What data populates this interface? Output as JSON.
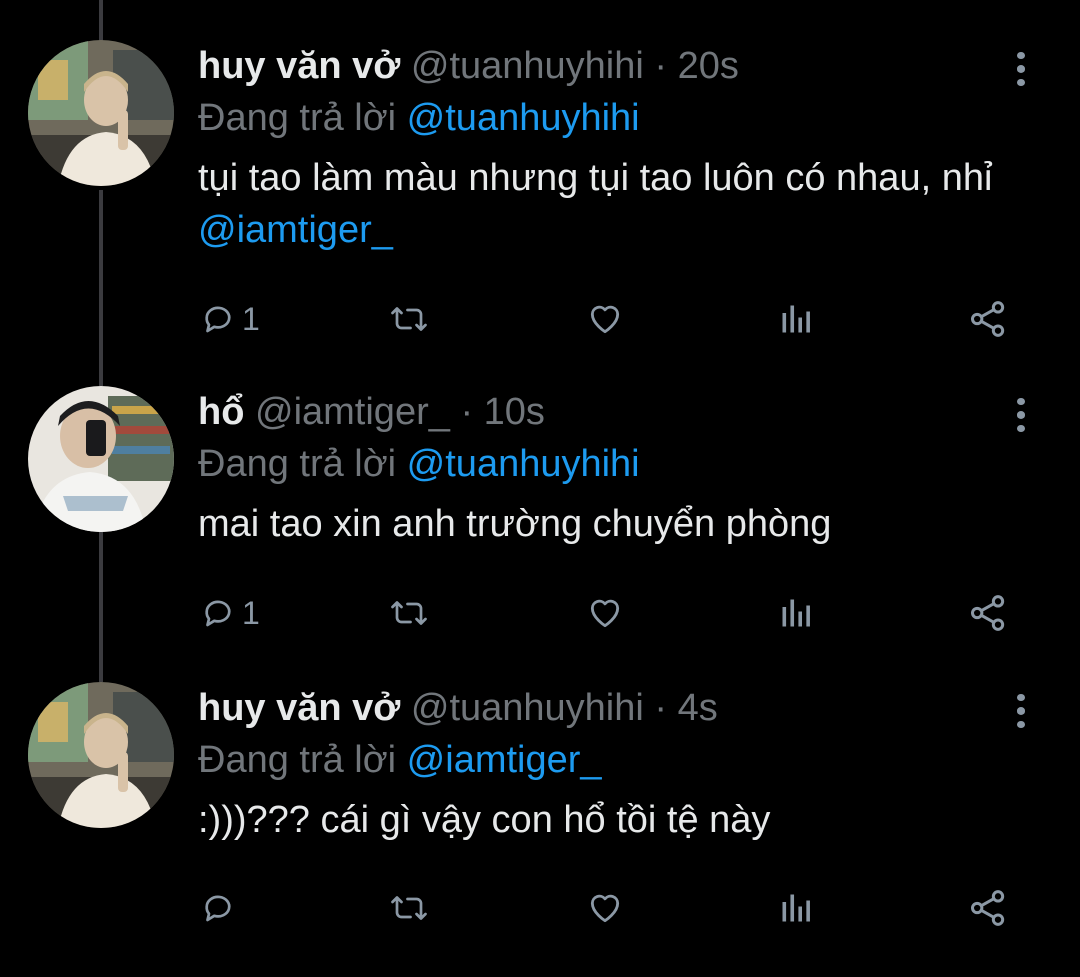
{
  "tweets": [
    {
      "display_name": "huy văn vở",
      "handle": "@tuanhuyhihi",
      "time": "· 20s",
      "reply_prefix": "Đang trả lời",
      "reply_to": "@tuanhuyhihi",
      "text": "tụi tao làm màu nhưng tụi tao luôn có nhau, nhỉ ",
      "text_mention": "@iamtiger_",
      "reply_count": "1"
    },
    {
      "display_name": "hổ",
      "handle": "@iamtiger_",
      "time": "· 10s",
      "reply_prefix": "Đang trả lời",
      "reply_to": "@tuanhuyhihi",
      "text": "mai tao xin anh trường chuyển phòng",
      "text_mention": "",
      "reply_count": "1"
    },
    {
      "display_name": "huy văn vở",
      "handle": "@tuanhuyhihi",
      "time": "· 4s",
      "reply_prefix": "Đang trả lời",
      "reply_to": "@iamtiger_",
      "text": ":)))??? cái gì vậy con hổ tồi tệ này",
      "text_mention": "",
      "reply_count": ""
    }
  ],
  "colors": {
    "background": "#000000",
    "primary_text": "#e7e9ea",
    "secondary_text": "#71767b",
    "accent": "#1d9bf0",
    "icon": "#8b98a5",
    "thread_line": "#3b3b3f"
  },
  "icons": [
    "reply-icon",
    "retweet-icon",
    "like-icon",
    "analytics-icon",
    "share-icon",
    "more-options-icon"
  ]
}
